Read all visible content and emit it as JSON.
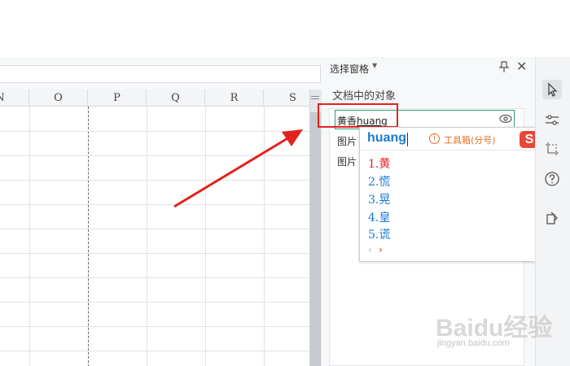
{
  "spreadsheet": {
    "columns": [
      "N",
      "O",
      "P",
      "Q",
      "R",
      "S"
    ]
  },
  "selection_pane": {
    "title": "选择窗格",
    "section_label": "文档中的对象",
    "editing_text_prefix": "黄香",
    "editing_text_typed": "huang",
    "rows": [
      "图片",
      "图片"
    ]
  },
  "ime": {
    "pinyin": "huang",
    "info_glyph": "i",
    "toolbox_label": "工具箱(分号)",
    "logo": "S",
    "candidates": [
      "1.黄",
      "2.慌",
      "3.晃",
      "4.皇",
      "5.谎"
    ],
    "prev_glyph": "‹",
    "next_glyph": "›",
    "colors": {
      "selected": "#e0231f",
      "normal": "#1a7ad6",
      "accent": "#e96f25"
    }
  },
  "toolbar": {
    "icons": [
      "cursor-icon",
      "settings-sliders-icon",
      "crop-icon",
      "help-icon",
      "attach-icon"
    ]
  },
  "watermark": {
    "brand": "Bai",
    "brand2": "du",
    "brand_cn": "经验",
    "url": "jingyan.baidu.com"
  },
  "annotation": {
    "highlight_color": "#e0231f"
  }
}
